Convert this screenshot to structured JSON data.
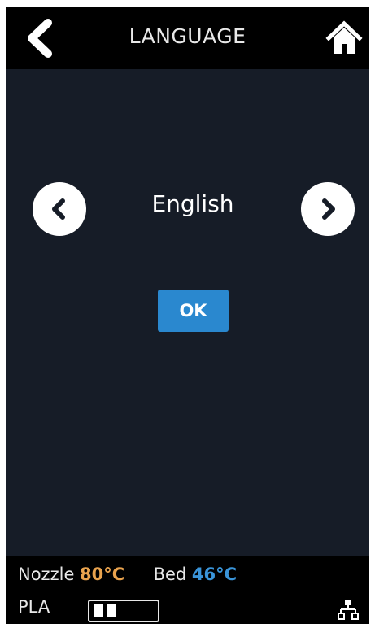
{
  "header": {
    "title": "LANGUAGE",
    "back_icon": "chevron-left-icon",
    "home_icon": "home-icon"
  },
  "selector": {
    "current_language": "English",
    "prev_icon": "chevron-left-circle-icon",
    "next_icon": "chevron-right-circle-icon"
  },
  "ok_button": {
    "label": "OK"
  },
  "status": {
    "nozzle_label": "Nozzle",
    "nozzle_temp": "80°C",
    "bed_label": "Bed",
    "bed_temp": "46°C",
    "material": "PLA",
    "network_icon": "network-icon"
  },
  "colors": {
    "background": "#161c27",
    "bar": "#000000",
    "accent_blue": "#2a88cf",
    "nozzle_orange": "#e9a34e",
    "bed_blue": "#3a95da"
  }
}
